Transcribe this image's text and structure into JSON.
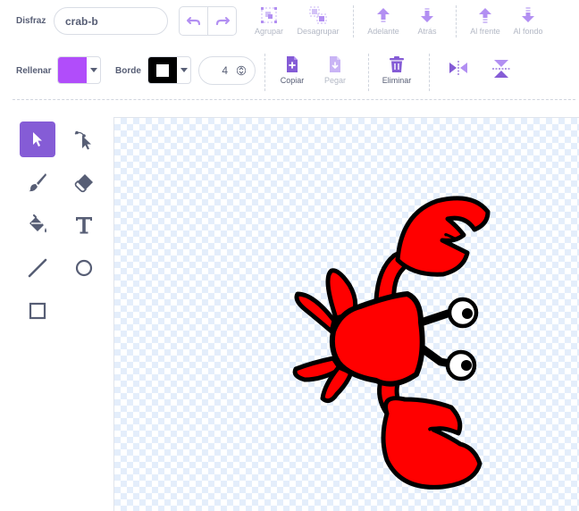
{
  "costume": {
    "label": "Disfraz",
    "name": "crab-b"
  },
  "history": {
    "undo_icon": "undo-icon",
    "redo_icon": "redo-icon"
  },
  "toolbar_top": [
    {
      "id": "group",
      "label": "Agrupar",
      "icon": "group-icon"
    },
    {
      "id": "ungroup",
      "label": "Desagrupar",
      "icon": "ungroup-icon"
    },
    {
      "id": "forward",
      "label": "Adelante",
      "icon": "forward-icon"
    },
    {
      "id": "backward",
      "label": "Atrás",
      "icon": "backward-icon"
    },
    {
      "id": "front",
      "label": "Al frente",
      "icon": "front-icon"
    },
    {
      "id": "back",
      "label": "Al fondo",
      "icon": "back-icon"
    }
  ],
  "fill": {
    "label": "Rellenar",
    "color": "#b14dfa"
  },
  "outline": {
    "label": "Borde",
    "color": "#000000",
    "width": "4"
  },
  "actions": [
    {
      "id": "copy",
      "label": "Copiar",
      "icon": "copy-icon"
    },
    {
      "id": "paste",
      "label": "Pegar",
      "icon": "paste-icon"
    },
    {
      "id": "delete",
      "label": "Eliminar",
      "icon": "trash-icon"
    }
  ],
  "flip": {
    "horizontal_icon": "flip-horizontal-icon",
    "vertical_icon": "flip-vertical-icon"
  },
  "tools": [
    {
      "id": "select",
      "icon": "select-arrow-icon",
      "selected": true
    },
    {
      "id": "reshape",
      "icon": "reshape-icon",
      "selected": false
    },
    {
      "id": "brush",
      "icon": "brush-icon",
      "selected": false
    },
    {
      "id": "eraser",
      "icon": "eraser-icon",
      "selected": false
    },
    {
      "id": "fill",
      "icon": "fill-bucket-icon",
      "selected": false
    },
    {
      "id": "text",
      "icon": "text-icon",
      "selected": false
    },
    {
      "id": "line",
      "icon": "line-icon",
      "selected": false
    },
    {
      "id": "circle",
      "icon": "circle-icon",
      "selected": false
    },
    {
      "id": "rectangle",
      "icon": "rectangle-icon",
      "selected": false
    }
  ],
  "colors": {
    "accent": "#855cd6",
    "accent_light": "#b28ff2",
    "crab_red": "#ff0000",
    "outline": "#000000"
  }
}
